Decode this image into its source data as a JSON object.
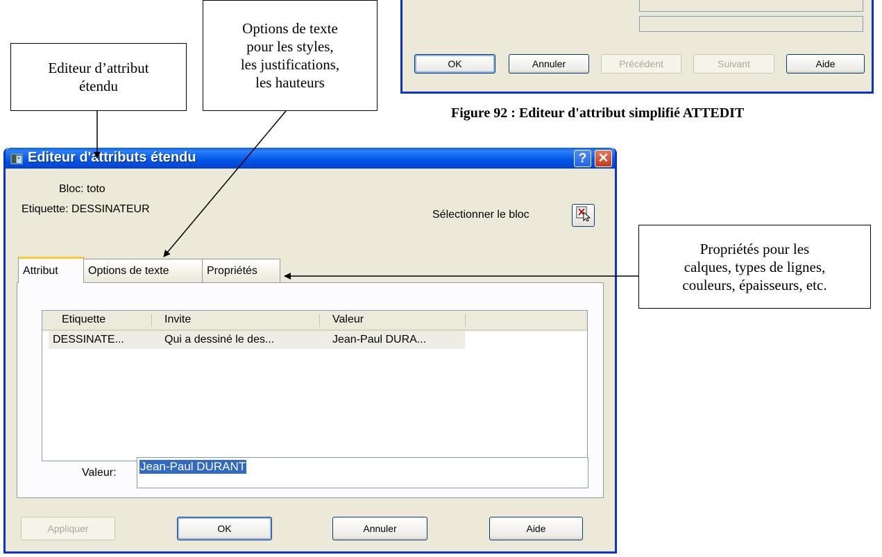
{
  "top_dialog": {
    "buttons": {
      "ok": "OK",
      "cancel": "Annuler",
      "previous": "Précédent",
      "next": "Suivant",
      "help": "Aide"
    }
  },
  "caption": "Figure 92 : Editeur d'attribut simplifié ATTEDIT",
  "callouts": {
    "extended_editor": [
      "Editeur d’attribut",
      "étendu"
    ],
    "text_options": [
      "Options de texte",
      "pour les styles,",
      "les justifications,",
      "les hauteurs"
    ],
    "properties": [
      "Propriétés pour les",
      "calques, types de lignes,",
      "couleurs, épaisseurs, etc."
    ]
  },
  "dialog": {
    "title": "Editeur d'attributs étendu",
    "help_glyph": "?",
    "close_glyph": "✕",
    "block_label": "Bloc: toto",
    "tag_label": "Etiquette: DESSINATEUR",
    "select_block_label": "Sélectionner le bloc",
    "tabs": [
      "Attribut",
      "Options de texte",
      "Propriétés"
    ],
    "list": {
      "columns": [
        "Etiquette",
        "Invite",
        "Valeur"
      ],
      "rows": [
        {
          "tag": "DESSINATE...",
          "prompt": "Qui a dessiné le des...",
          "value": "Jean-Paul DURA..."
        }
      ]
    },
    "value_label": "Valeur:",
    "value_input": "Jean-Paul DURANT",
    "buttons": {
      "apply": "Appliquer",
      "ok": "OK",
      "cancel": "Annuler",
      "help": "Aide"
    }
  },
  "icons": [
    "app-icon",
    "select-block-icon"
  ],
  "colors": {
    "title_bar": "#0055e5",
    "dialog_bg": "#ece9d8",
    "selection": "#316ac5",
    "active_tab_accent": "#ffc83c"
  }
}
